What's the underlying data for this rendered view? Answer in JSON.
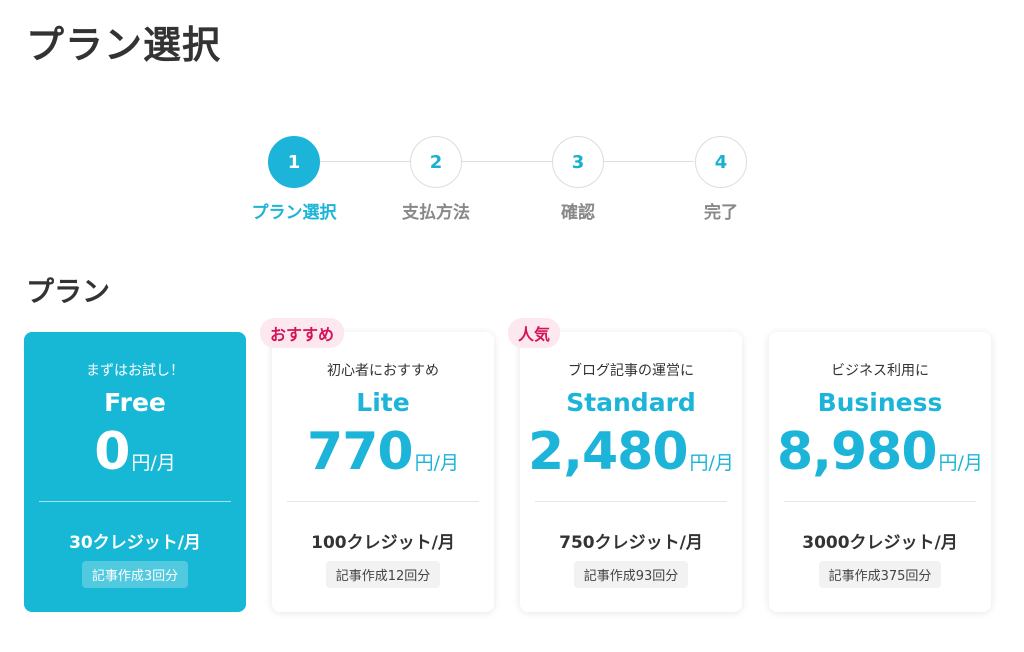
{
  "page": {
    "title": "プラン選択"
  },
  "stepper": {
    "steps": [
      {
        "number": "1",
        "label": "プラン選択",
        "active": true
      },
      {
        "number": "2",
        "label": "支払方法",
        "active": false
      },
      {
        "number": "3",
        "label": "確認",
        "active": false
      },
      {
        "number": "4",
        "label": "完了",
        "active": false
      }
    ]
  },
  "plans_section": {
    "title": "プラン"
  },
  "plans": [
    {
      "badge": "",
      "tagline": "まずはお試し！",
      "name": "Free",
      "price": "0",
      "unit": "円/月",
      "credits": "30クレジット/月",
      "articles": "記事作成3回分",
      "selected": true
    },
    {
      "badge": "おすすめ",
      "tagline": "初心者におすすめ",
      "name": "Lite",
      "price": "770",
      "unit": "円/月",
      "credits": "100クレジット/月",
      "articles": "記事作成12回分",
      "selected": false
    },
    {
      "badge": "人気",
      "tagline": "ブログ記事の運営に",
      "name": "Standard",
      "price": "2,480",
      "unit": "円/月",
      "credits": "750クレジット/月",
      "articles": "記事作成93回分",
      "selected": false
    },
    {
      "badge": "",
      "tagline": "ビジネス利用に",
      "name": "Business",
      "price": "8,980",
      "unit": "円/月",
      "credits": "3000クレジット/月",
      "articles": "記事作成375回分",
      "selected": false
    }
  ],
  "colors": {
    "accent": "#1cb4d8",
    "selected_card": "#17b8d6",
    "badge_text": "#d4145a",
    "badge_bg": "#fde8ef"
  }
}
